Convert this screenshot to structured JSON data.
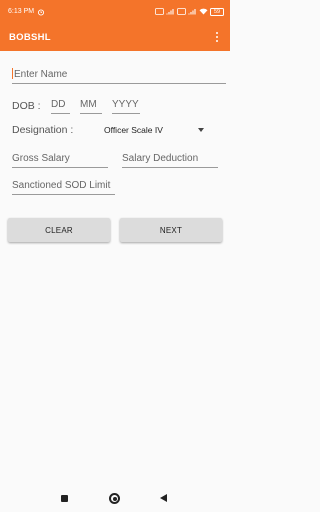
{
  "status_bar": {
    "time": "6:13 PM",
    "icons": [
      "alarm-icon",
      "hd-icon",
      "signal-icon",
      "hd-icon",
      "signal-icon",
      "wifi-icon",
      "battery-icon"
    ],
    "battery": "59"
  },
  "app_bar": {
    "title": "BOBSHL",
    "menu_icon": "overflow-menu-icon"
  },
  "form": {
    "name_placeholder": "Enter Name",
    "dob_label": "DOB :",
    "dd_placeholder": "DD",
    "mm_placeholder": "MM",
    "yyyy_placeholder": "YYYY",
    "designation_label": "Designation :",
    "designation_value": "Officer Scale IV",
    "gross_salary_placeholder": "Gross Salary",
    "salary_deduction_placeholder": "Salary Deduction",
    "sod_limit_placeholder": "Sanctioned SOD Limit"
  },
  "buttons": {
    "clear_label": "CLEAR",
    "next_label": "NEXT"
  },
  "colors": {
    "accent": "#f4742a"
  }
}
